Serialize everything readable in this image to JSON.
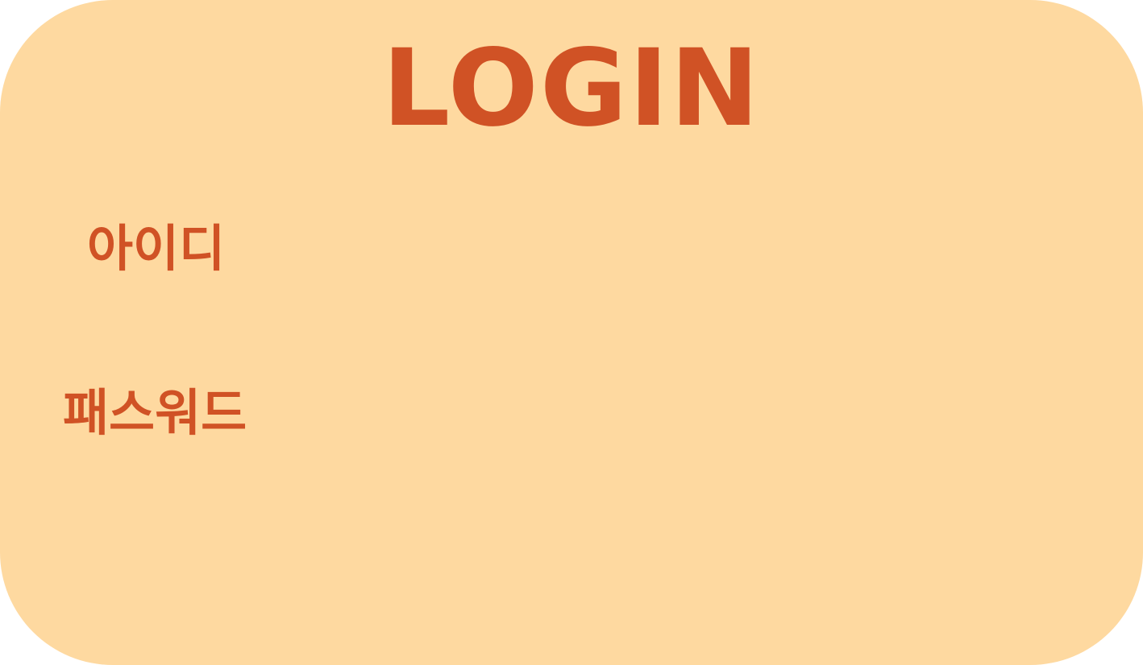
{
  "login_form": {
    "title": "LOGIN",
    "id_label": "아이디",
    "id_value": "",
    "password_label": "패스워드",
    "password_value": ""
  },
  "colors": {
    "background": "#fed9a0",
    "accent": "#d05225"
  }
}
